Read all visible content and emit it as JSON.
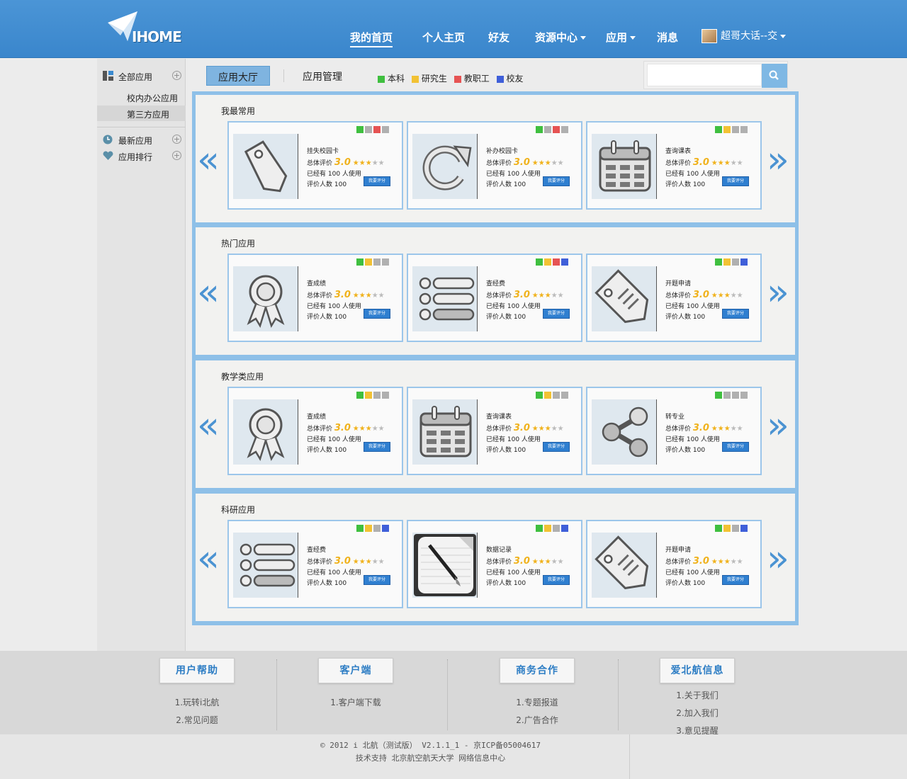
{
  "brand": {
    "logo_text": "IHOME"
  },
  "nav": {
    "items": [
      {
        "label": "我的首页",
        "active": true
      },
      {
        "label": "个人主页"
      },
      {
        "label": "好友"
      },
      {
        "label": "资源中心"
      },
      {
        "label": "应用"
      },
      {
        "label": "消息"
      }
    ],
    "user": "超哥大话--交"
  },
  "sidebar": {
    "all_apps": "全部应用",
    "sub": [
      "校内办公应用",
      "第三方应用"
    ],
    "latest": "最新应用",
    "ranking": "应用排行"
  },
  "tabs": [
    "应用大厅",
    "应用管理"
  ],
  "legend": [
    {
      "label": "本科",
      "color": "#3fbf3f"
    },
    {
      "label": "研究生",
      "color": "#f2c234"
    },
    {
      "label": "教职工",
      "color": "#e65353"
    },
    {
      "label": "校友",
      "color": "#3f5fd9"
    }
  ],
  "search": {
    "placeholder": ""
  },
  "card_text": {
    "rating_label": "总体评价",
    "score": "3.0",
    "used_text": "已经有 100 人使用",
    "reviews_text": "评价人数 100",
    "rate_button": "我要评分"
  },
  "sections": [
    {
      "title": "我最常用",
      "cards": [
        {
          "name": "挂失校园卡",
          "icon": "tag-icon",
          "dots": [
            "#3fbf3f",
            "#b0b0b0",
            "#e65353",
            "#b0b0b0"
          ]
        },
        {
          "name": "补办校园卡",
          "icon": "refresh-icon",
          "dots": [
            "#3fbf3f",
            "#b0b0b0",
            "#e65353",
            "#b0b0b0"
          ]
        },
        {
          "name": "查询课表",
          "icon": "calendar-icon",
          "dots": [
            "#3fbf3f",
            "#f2c234",
            "#b0b0b0",
            "#b0b0b0"
          ]
        }
      ]
    },
    {
      "title": "热门应用",
      "cards": [
        {
          "name": "查成绩",
          "icon": "ribbon-icon",
          "dots": [
            "#3fbf3f",
            "#f2c234",
            "#b0b0b0",
            "#b0b0b0"
          ]
        },
        {
          "name": "查经费",
          "icon": "list-icon",
          "dots": [
            "#3fbf3f",
            "#f2c234",
            "#e65353",
            "#3f5fd9"
          ]
        },
        {
          "name": "开题申请",
          "icon": "tag-lines-icon",
          "dots": [
            "#3fbf3f",
            "#f2c234",
            "#b0b0b0",
            "#3f5fd9"
          ]
        }
      ]
    },
    {
      "title": "教学类应用",
      "cards": [
        {
          "name": "查成绩",
          "icon": "ribbon-icon",
          "dots": [
            "#3fbf3f",
            "#f2c234",
            "#b0b0b0",
            "#b0b0b0"
          ]
        },
        {
          "name": "查询课表",
          "icon": "calendar-icon",
          "dots": [
            "#3fbf3f",
            "#f2c234",
            "#b0b0b0",
            "#b0b0b0"
          ]
        },
        {
          "name": "转专业",
          "icon": "share-icon",
          "dots": [
            "#3fbf3f",
            "#b0b0b0",
            "#b0b0b0",
            "#b0b0b0"
          ]
        }
      ]
    },
    {
      "title": "科研应用",
      "cards": [
        {
          "name": "查经费",
          "icon": "list-icon",
          "dots": [
            "#3fbf3f",
            "#f2c234",
            "#b0b0b0",
            "#3f5fd9"
          ]
        },
        {
          "name": "数据记录",
          "icon": "notepad-icon",
          "dots": [
            "#3fbf3f",
            "#f2c234",
            "#b0b0b0",
            "#3f5fd9"
          ]
        },
        {
          "name": "开题申请",
          "icon": "tag-lines-icon",
          "dots": [
            "#3fbf3f",
            "#f2c234",
            "#b0b0b0",
            "#3f5fd9"
          ]
        }
      ]
    }
  ],
  "footer": {
    "columns": [
      {
        "title": "用户帮助",
        "links": [
          "1.玩转i北航",
          "2.常见问题"
        ]
      },
      {
        "title": "客户端",
        "links": [
          "1.客户端下载"
        ]
      },
      {
        "title": "商务合作",
        "links": [
          "1.专题报道",
          "2.广告合作"
        ]
      },
      {
        "title": "爱北航信息",
        "links": [
          "1.关于我们",
          "2.加入我们",
          "3.意见提醒"
        ]
      }
    ],
    "copyright": "© 2012 i 北航（测试版） V2.1.1_1 - 京ICP备05004617",
    "support": "技术支持 北京航空航天大学 网络信息中心"
  }
}
